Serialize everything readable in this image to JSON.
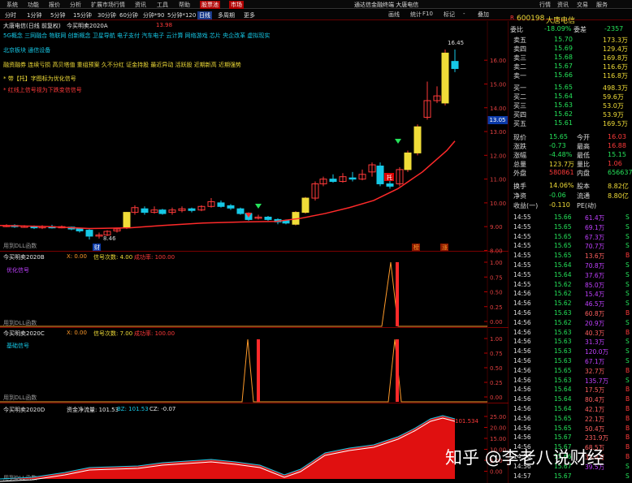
{
  "menubar": {
    "items": [
      "系统",
      "功能",
      "报价",
      "分析",
      "扩展市场行情",
      "资讯",
      "工具",
      "帮助"
    ],
    "active": [
      "股票池",
      "市场"
    ],
    "title": "通达信金融终端  大唐电信",
    "right": [
      "行情",
      "资讯",
      "交易",
      "服务"
    ]
  },
  "periods": [
    "分时",
    "1分钟",
    "5分钟",
    "15分钟",
    "30分钟",
    "60分钟",
    "分钟*90",
    "5分钟*120",
    "日线",
    "多周期",
    "更多"
  ],
  "active_period": "日线",
  "side_tabs": [
    "画线",
    "F10",
    "标记",
    "-",
    "叠加",
    "统计"
  ],
  "main_panel": {
    "title": "大唐电信(日线 前复权)",
    "indicator": "今买明卖2020A",
    "top_value": "13.98",
    "concepts1": "5G概念  三网融合  物联网  创新概念  卫星导航  电子支付  汽车电子  云计算  网络游戏  芯片  央企改革  虚拟现实",
    "concepts2": "北京板块  通信设备",
    "concepts3": "融资融券  连续亏损  高贝塔值  重组预案  久不分红  证金持股  最近异动  活跃股  近期新高  近期强势",
    "note1": "* 带【托】字图标为优化信号",
    "note2": "* 红线上信号视为下跌变信信号",
    "dll": "用到DLL函数",
    "ticks": [
      "16.00",
      "15.00",
      "14.00",
      "13.00",
      "12.00",
      "11.00",
      "10.00",
      "9.00",
      "8.00"
    ],
    "high_label": "16.45",
    "low_label": "8.46",
    "tuo_label": "托",
    "markers": [
      "财",
      "榜",
      "涨"
    ]
  },
  "price_tag": "13.05",
  "sub_b": {
    "title": "今买明卖2020B",
    "x": "X: 0.00",
    "signals": "信号次数: 4.00",
    "success": "成功率: 100.00",
    "label": "优化信号",
    "dll": "用到DLL函数",
    "ticks": [
      "1.00",
      "0.75",
      "0.50",
      "0.25",
      "0.00"
    ]
  },
  "sub_c": {
    "title": "今买明卖2020C",
    "x": "X: 0.00",
    "signals": "信号次数: 7.00",
    "success": "成功率: 100.00",
    "label": "基础信号",
    "dll": "用到DLL函数",
    "ticks": [
      "1.00",
      "0.75",
      "0.50",
      "0.25",
      "0.00"
    ]
  },
  "sub_d": {
    "title": "今买明卖2020D",
    "flow": "资金净流量: 101.53",
    "bz": "BZ: 101.53",
    "cz": "CZ: -0.07",
    "val_label": "101.534",
    "dll": "用到DLL函数",
    "ticks": [
      "25.00",
      "20.00",
      "15.00",
      "10.00",
      "5.00",
      "0.00"
    ]
  },
  "stock": {
    "code": "600198",
    "name": "大唐电信"
  },
  "weibi": {
    "label1": "委比",
    "val1": "-18.09%",
    "label2": "委差",
    "val2": "-2357"
  },
  "asks": [
    [
      "卖五",
      "15.70",
      "173.3万"
    ],
    [
      "卖四",
      "15.69",
      "129.4万"
    ],
    [
      "卖三",
      "15.68",
      "169.8万"
    ],
    [
      "卖二",
      "15.67",
      "116.6万"
    ],
    [
      "卖一",
      "15.66",
      "116.8万"
    ]
  ],
  "bids": [
    [
      "买一",
      "15.65",
      "498.3万"
    ],
    [
      "买二",
      "15.64",
      "59.6万"
    ],
    [
      "买三",
      "15.63",
      "53.0万"
    ],
    [
      "买四",
      "15.62",
      "53.9万"
    ],
    [
      "买五",
      "15.61",
      "169.5万"
    ]
  ],
  "stats": [
    [
      "现价",
      "15.65",
      "今开",
      "16.03"
    ],
    [
      "涨跌",
      "-0.73",
      "最高",
      "16.88"
    ],
    [
      "涨幅",
      "-4.48%",
      "最低",
      "15.15"
    ],
    [
      "总量",
      "123.7万",
      "量比",
      "1.06"
    ],
    [
      "外盘",
      "580861",
      "内盘",
      "656637"
    ]
  ],
  "stats2": [
    [
      "换手",
      "14.06%",
      "股本",
      "8.82亿"
    ],
    [
      "净资",
      "-0.06",
      "流通",
      "8.80亿"
    ],
    [
      "收益(一)",
      "-0.110",
      "PE(动)",
      ""
    ]
  ],
  "trades": [
    [
      "14:55",
      "15.66",
      "61.4万",
      "S"
    ],
    [
      "14:55",
      "15.65",
      "69.1万",
      "S"
    ],
    [
      "14:55",
      "15.65",
      "67.3万",
      "S"
    ],
    [
      "14:55",
      "15.65",
      "70.7万",
      "S"
    ],
    [
      "14:55",
      "15.65",
      "13.6万",
      "B"
    ],
    [
      "14:55",
      "15.64",
      "70.8万",
      "S"
    ],
    [
      "14:55",
      "15.64",
      "37.6万",
      "S"
    ],
    [
      "14:55",
      "15.62",
      "85.0万",
      "S"
    ],
    [
      "14:56",
      "15.62",
      "15.4万",
      "S"
    ],
    [
      "14:56",
      "15.62",
      "46.5万",
      "S"
    ],
    [
      "14:56",
      "15.63",
      "60.8万",
      "B"
    ],
    [
      "14:56",
      "15.62",
      "20.9万",
      "S"
    ],
    [
      "14:56",
      "15.63",
      "40.3万",
      "B"
    ],
    [
      "14:56",
      "15.63",
      "31.3万",
      "S"
    ],
    [
      "14:56",
      "15.63",
      "120.0万",
      "S"
    ],
    [
      "14:56",
      "15.63",
      "67.1万",
      "S"
    ],
    [
      "14:56",
      "15.65",
      "32.7万",
      "B"
    ],
    [
      "14:56",
      "15.63",
      "135.7万",
      "S"
    ],
    [
      "14:56",
      "15.64",
      "17.5万",
      "B"
    ],
    [
      "14:56",
      "15.64",
      "80.4万",
      "B"
    ],
    [
      "14:56",
      "15.64",
      "42.1万",
      "B"
    ],
    [
      "14:56",
      "15.65",
      "22.1万",
      "B"
    ],
    [
      "14:56",
      "15.65",
      "50.4万",
      "B"
    ],
    [
      "14:56",
      "15.67",
      "231.9万",
      "B"
    ],
    [
      "14:56",
      "15.67",
      "68.5万",
      "B"
    ],
    [
      "14:56",
      "15.66",
      "33.4万",
      "B"
    ],
    [
      "14:56",
      "15.67",
      "39.5万",
      "S"
    ],
    [
      "14:57",
      "15.67",
      "",
      "S"
    ]
  ],
  "watermark": "知乎 @李老八说财经",
  "colors": {
    "up": "#ff3a3a",
    "down": "#25e35a",
    "signal": "#ff9a2a",
    "neutral": "#e8e8e8",
    "price_yellow": "#f0dc38"
  }
}
